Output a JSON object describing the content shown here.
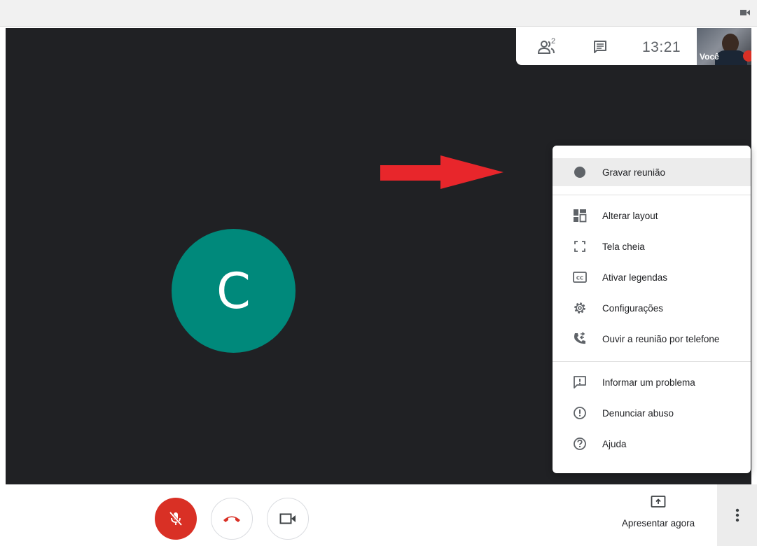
{
  "call": {
    "participants_count": "2",
    "clock": "13:21",
    "self_label": "Você",
    "participant_initial": "C"
  },
  "menu": {
    "items": [
      {
        "label": "Gravar reunião",
        "icon": "record-dot-icon"
      },
      {
        "label": "Alterar layout",
        "icon": "layout-icon"
      },
      {
        "label": "Tela cheia",
        "icon": "fullscreen-icon"
      },
      {
        "label": "Ativar legendas",
        "icon": "captions-icon"
      },
      {
        "label": "Configurações",
        "icon": "gear-icon"
      },
      {
        "label": "Ouvir a reunião por telefone",
        "icon": "phone-forward-icon"
      },
      {
        "label": "Informar um problema",
        "icon": "feedback-icon"
      },
      {
        "label": "Denunciar abuso",
        "icon": "alert-circle-icon"
      },
      {
        "label": "Ajuda",
        "icon": "help-icon"
      }
    ]
  },
  "controls": {
    "present_label": "Apresentar agora",
    "mic_state": "muted",
    "end_call_color": "#d93025",
    "mic_button_color": "#d93025"
  },
  "colors": {
    "stage_background": "#202124",
    "avatar_background": "#00897b",
    "annotation_arrow": "#e8262b"
  }
}
